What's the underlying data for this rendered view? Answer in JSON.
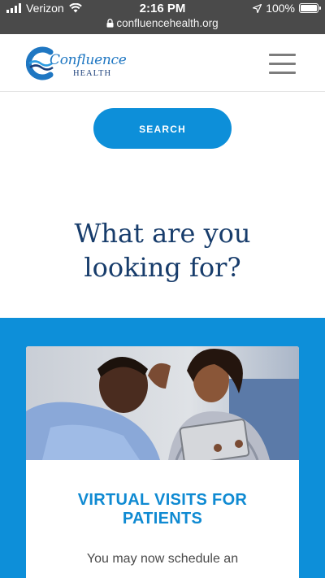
{
  "status_bar": {
    "carrier": "Verizon",
    "time": "2:16 PM",
    "url": "confluencehealth.org",
    "battery": "100%",
    "signal_icon": "signal-bars-icon",
    "wifi_icon": "wifi-icon",
    "lock_icon": "lock-icon",
    "location_icon": "location-arrow-icon",
    "battery_icon": "battery-icon"
  },
  "header": {
    "logo_word": "Confluence",
    "logo_sub": "HEALTH",
    "menu_icon": "hamburger-menu-icon"
  },
  "search": {
    "label": "SEARCH"
  },
  "main": {
    "heading_line1": "What are you",
    "heading_line2": "looking for?"
  },
  "card": {
    "image_alt": "virtual-visit-photo",
    "title_line1": "VIRTUAL VISITS FOR",
    "title_line2": "PATIENTS",
    "text": "You may now schedule an"
  },
  "colors": {
    "status_bg": "#4a4a4a",
    "brand_blue": "#0d8fd9",
    "heading_navy": "#173c6b",
    "menu_gray": "#7d7d7d"
  }
}
